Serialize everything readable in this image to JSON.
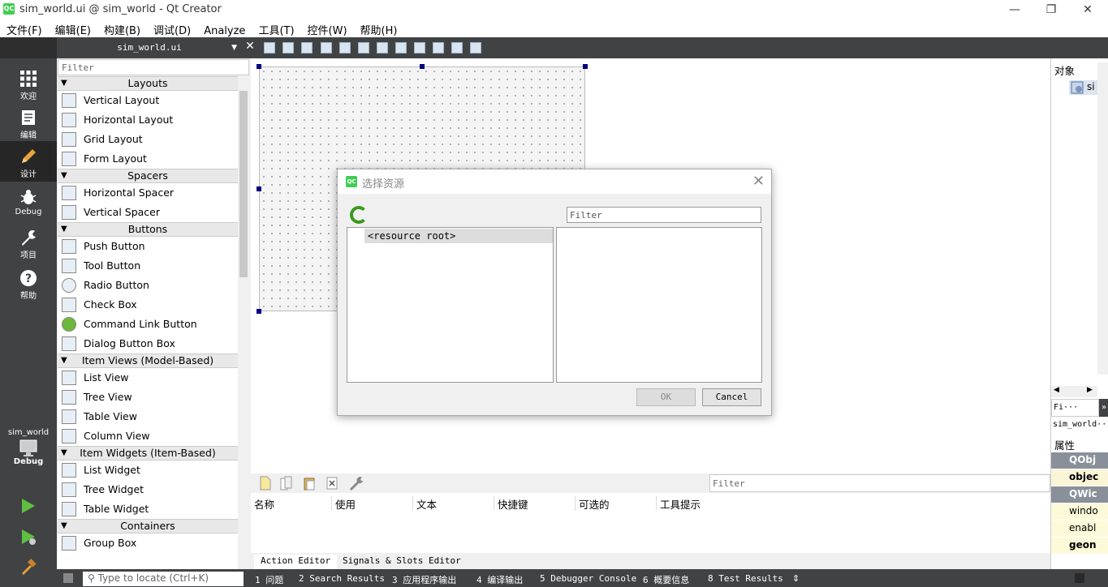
{
  "window": {
    "title": "sim_world.ui @ sim_world - Qt Creator",
    "logo": "QC",
    "min": "—",
    "max": "❐",
    "close": "✕"
  },
  "menu": [
    "文件(F)",
    "编辑(E)",
    "构建(B)",
    "调试(D)",
    "Analyze",
    "工具(T)",
    "控件(W)",
    "帮助(H)"
  ],
  "editor": {
    "filename": "sim_world.ui"
  },
  "modes": [
    {
      "label": "欢迎",
      "icon": "grid-icon"
    },
    {
      "label": "编辑",
      "icon": "document-icon"
    },
    {
      "label": "设计",
      "icon": "pencil-icon"
    },
    {
      "label": "Debug",
      "icon": "bug-icon"
    },
    {
      "label": "项目",
      "icon": "wrench-icon"
    },
    {
      "label": "帮助",
      "icon": "help-icon"
    }
  ],
  "kit": {
    "project": "sim_world",
    "config": "Debug"
  },
  "widgetbox": {
    "filter": "Filter",
    "categories": [
      {
        "name": "Layouts",
        "items": [
          "Vertical Layout",
          "Horizontal Layout",
          "Grid Layout",
          "Form Layout"
        ]
      },
      {
        "name": "Spacers",
        "items": [
          "Horizontal Spacer",
          "Vertical Spacer"
        ]
      },
      {
        "name": "Buttons",
        "items": [
          "Push Button",
          "Tool Button",
          "Radio Button",
          "Check Box",
          "Command Link Button",
          "Dialog Button Box"
        ]
      },
      {
        "name": "Item Views (Model-Based)",
        "items": [
          "List View",
          "Tree View",
          "Table View",
          "Column View"
        ]
      },
      {
        "name": "Item Widgets (Item-Based)",
        "items": [
          "List Widget",
          "Tree Widget",
          "Table Widget"
        ]
      },
      {
        "name": "Containers",
        "items": [
          "Group Box"
        ]
      }
    ]
  },
  "dialog": {
    "title": "选择资源",
    "filter_placeholder": "Filter",
    "tree_root": "<resource root>",
    "ok": "OK",
    "cancel": "Cancel"
  },
  "action_editor": {
    "filter": "Filter",
    "columns": [
      "名称",
      "使用",
      "文本",
      "快捷键",
      "可选的",
      "工具提示"
    ],
    "tabs": [
      "Action Editor",
      "Signals & Slots Editor"
    ]
  },
  "right_panel": {
    "objects_label": "对象",
    "object_item": "si",
    "filter": "Fi···",
    "object_name": "sim_world···",
    "properties_label": "属性",
    "props": [
      "QObj",
      "objec",
      "QWic",
      "windo",
      "enabl",
      "geon"
    ]
  },
  "status": {
    "locator": "Type to locate (Ctrl+K)",
    "panes": [
      "1  问题",
      "2  Search Results",
      "3  应用程序输出",
      "4  编译输出",
      "5  Debugger Console",
      "6  概要信息",
      "8  Test Results"
    ]
  },
  "colors": {
    "accent_green": "#41cd52",
    "sidebar": "#404244",
    "handle": "#000080"
  }
}
